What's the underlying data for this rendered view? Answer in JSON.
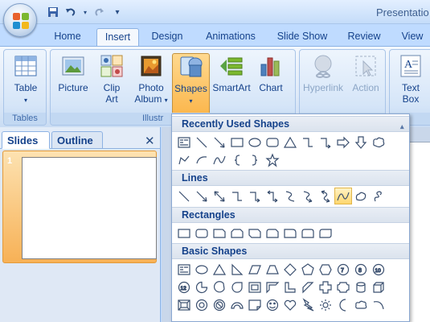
{
  "title": "Presentatio",
  "qat": [
    "save-icon",
    "undo-icon",
    "redo-icon",
    "customize-icon"
  ],
  "tabs": [
    {
      "label": "Home"
    },
    {
      "label": "Insert",
      "active": true
    },
    {
      "label": "Design"
    },
    {
      "label": "Animations"
    },
    {
      "label": "Slide Show"
    },
    {
      "label": "Review"
    },
    {
      "label": "View"
    }
  ],
  "ribbon": {
    "groups": {
      "tables": "Tables",
      "illustrations": "Illustr",
      "links": "",
      "text": ""
    },
    "buttons": {
      "table": "Table",
      "picture": "Picture",
      "clip_art_1": "Clip",
      "clip_art_2": "Art",
      "photo_album_1": "Photo",
      "photo_album_2": "Album",
      "shapes": "Shapes",
      "smartart": "SmartArt",
      "chart": "Chart",
      "hyperlink": "Hyperlink",
      "action": "Action",
      "text_box_1": "Text",
      "text_box_2": "Box"
    }
  },
  "left_pane": {
    "tabs": [
      "Slides",
      "Outline"
    ],
    "close": "✕",
    "slide_number": "1"
  },
  "shapes_menu": {
    "sections": {
      "recent": "Recently Used Shapes",
      "lines": "Lines",
      "rectangles": "Rectangles",
      "basic": "Basic Shapes"
    }
  },
  "colors": {
    "accent": "#15428b",
    "ribbon_bg": "#dfeaf8",
    "pressed": "#fbb54a"
  }
}
